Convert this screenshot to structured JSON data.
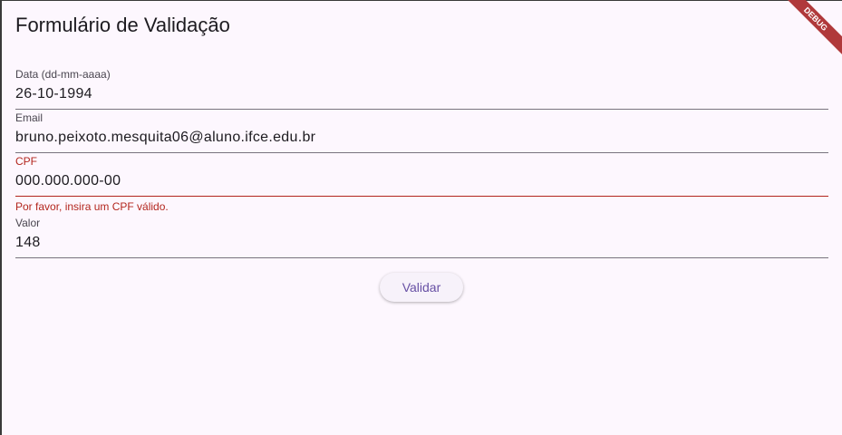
{
  "title": "Formulário de Validação",
  "fields": [
    {
      "label": "Data (dd-mm-aaaa)",
      "value": "26-10-1994"
    },
    {
      "label": "Email",
      "value": "bruno.peixoto.mesquita06@aluno.ifce.edu.br"
    },
    {
      "label": "CPF",
      "value": "000.000.000-00",
      "error": "Por favor, insira um CPF válido."
    },
    {
      "label": "Valor",
      "value": "148"
    }
  ],
  "button": "Validar",
  "debug": "DEBUG",
  "colors": {
    "error": "#b3261e",
    "accent": "#6750a4",
    "background": "#fdf7fe"
  }
}
